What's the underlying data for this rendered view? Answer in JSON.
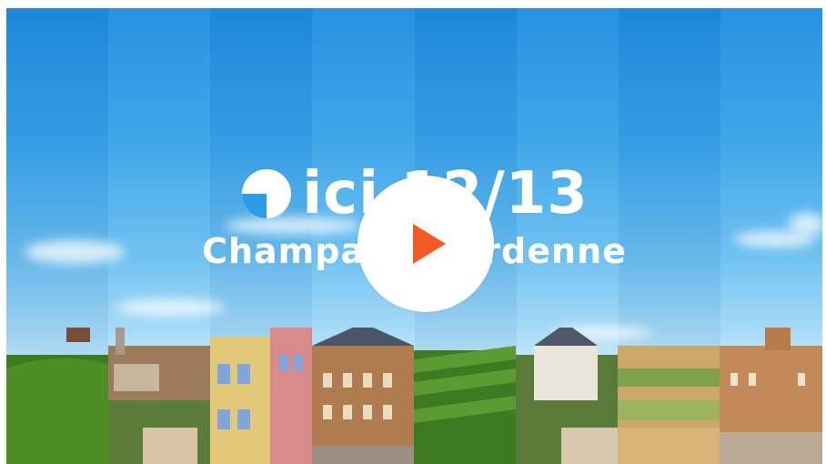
{
  "video": {
    "logo_text": "ici 12/13",
    "subtitle": "Champagne-Ardenne",
    "play_icon": "play-icon",
    "accent_color": "#f15a22"
  }
}
